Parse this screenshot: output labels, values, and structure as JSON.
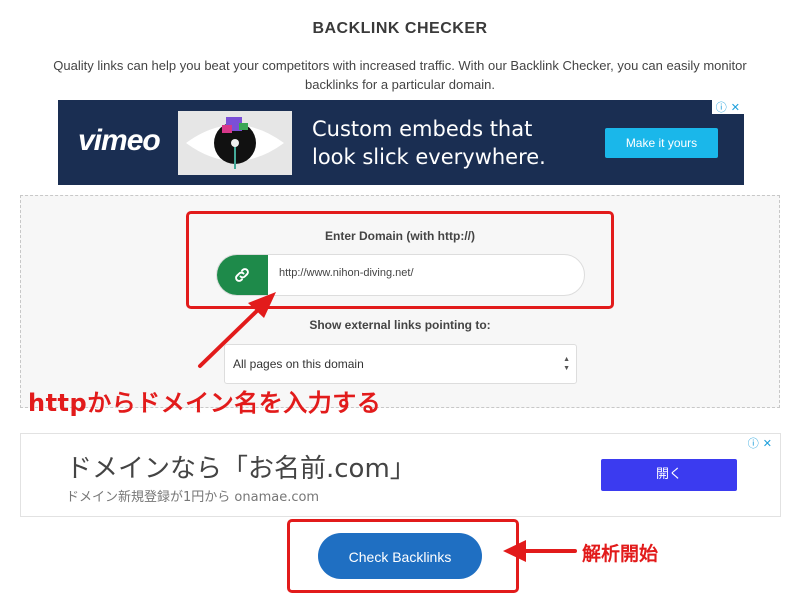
{
  "page": {
    "title": "BACKLINK CHECKER",
    "description": "Quality links can help you beat your competitors with increased traffic. With our Backlink Checker, you can easily monitor backlinks for a particular domain."
  },
  "ad_vimeo": {
    "logo": "vimeo",
    "headline_line1": "Custom embeds that",
    "headline_line2": "look slick everywhere.",
    "cta": "Make it yours",
    "adchoice_info": "ⓘ",
    "adchoice_close": "✕"
  },
  "form": {
    "domain_label": "Enter Domain (with http://)",
    "domain_value": "http://www.nihon-diving.net/",
    "external_label": "Show external links pointing to:",
    "scope_selected": "All pages on this domain",
    "link_icon": "link-icon"
  },
  "annotations": {
    "enter_domain_note": "httpからドメイン名を入力する",
    "start_note": "解析開始",
    "color": "#e21b1b"
  },
  "ad_onamae": {
    "headline": "ドメインなら「お名前.com」",
    "sub": "ドメイン新規登録が1円から onamae.com",
    "cta": "開く",
    "adchoice_info": "ⓘ",
    "adchoice_close": "✕"
  },
  "submit": {
    "label": "Check Backlinks"
  },
  "colors": {
    "accent_green": "#1e8a4a",
    "button_blue": "#1f6fc2",
    "vimeo_bg": "#1a2e52",
    "vimeo_cta": "#1ab7ea",
    "onamae_cta": "#3b3bf0"
  }
}
